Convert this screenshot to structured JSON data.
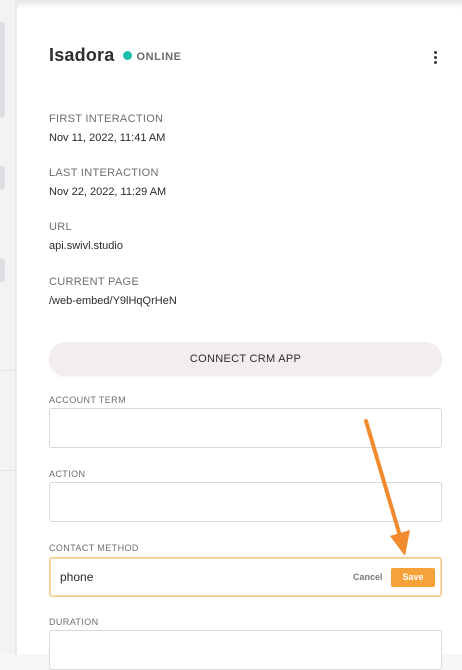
{
  "contact": {
    "name": "Isadora",
    "status": "ONLINE"
  },
  "details": [
    {
      "label": "FIRST INTERACTION",
      "value": "Nov 11, 2022, 11:41 AM"
    },
    {
      "label": "LAST INTERACTION",
      "value": "Nov 22, 2022, 11:29 AM"
    },
    {
      "label": "URL",
      "value": "api.swivl.studio"
    },
    {
      "label": "CURRENT PAGE",
      "value": "/web-embed/Y9lHqQrHeN"
    }
  ],
  "crm": {
    "button_label": "CONNECT CRM APP"
  },
  "fields": [
    {
      "label": "ACCOUNT TERM",
      "value": ""
    },
    {
      "label": "ACTION",
      "value": ""
    },
    {
      "label": "CONTACT METHOD",
      "value": "phone",
      "cancel_label": "Cancel",
      "save_label": "Save"
    },
    {
      "label": "DURATION",
      "value": ""
    }
  ],
  "colors": {
    "status_online": "#1fbfae",
    "accent_save": "#f7a13a",
    "annotation_arrow": "#f28a2e"
  },
  "icons": {
    "more": "more-vertical-icon",
    "status": "online-dot-icon",
    "annotation": "arrow-annotation-icon"
  }
}
